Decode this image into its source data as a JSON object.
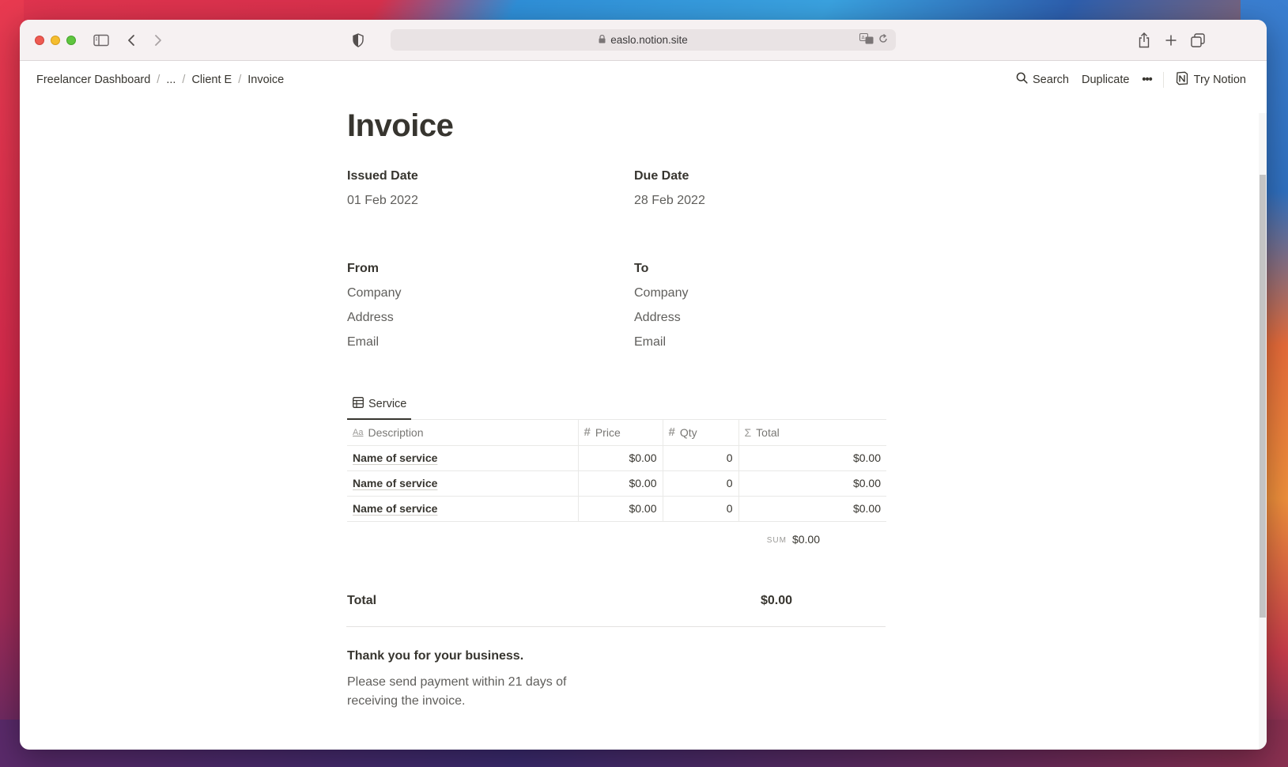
{
  "browser": {
    "url": "easlo.notion.site"
  },
  "breadcrumb": {
    "items": [
      "Freelancer Dashboard",
      "...",
      "Client E",
      "Invoice"
    ],
    "separator": "/"
  },
  "topbar": {
    "search_label": "Search",
    "duplicate_label": "Duplicate",
    "more_label": "•••",
    "try_notion_label": "Try Notion"
  },
  "page": {
    "title": "Invoice"
  },
  "dates": {
    "issued_label": "Issued Date",
    "issued_value": "01 Feb 2022",
    "due_label": "Due Date",
    "due_value": "28 Feb 2022"
  },
  "from": {
    "label": "From",
    "company": "Company",
    "address": "Address",
    "email": "Email"
  },
  "to": {
    "label": "To",
    "company": "Company",
    "address": "Address",
    "email": "Email"
  },
  "service_table": {
    "tab_label": "Service",
    "columns": [
      "Description",
      "Price",
      "Qty",
      "Total"
    ],
    "rows": [
      {
        "description": "Name of service",
        "price": "$0.00",
        "qty": "0",
        "total": "$0.00"
      },
      {
        "description": "Name of service",
        "price": "$0.00",
        "qty": "0",
        "total": "$0.00"
      },
      {
        "description": "Name of service",
        "price": "$0.00",
        "qty": "0",
        "total": "$0.00"
      }
    ],
    "sum_label": "SUM",
    "sum_value": "$0.00"
  },
  "total": {
    "label": "Total",
    "value": "$0.00"
  },
  "footer": {
    "thanks": "Thank you for your business.",
    "note": "Please send payment within 21 days of receiving the invoice."
  },
  "colors": {
    "text": "#37352f",
    "muted": "#5f5e5b",
    "border": "#e9e9e7"
  }
}
